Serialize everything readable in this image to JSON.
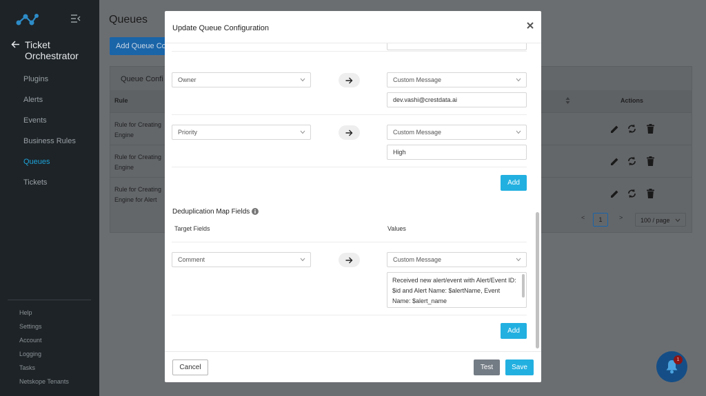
{
  "sidebar": {
    "title_line1": "Ticket",
    "title_line2": "Orchestrator",
    "items": [
      {
        "label": "Plugins"
      },
      {
        "label": "Alerts"
      },
      {
        "label": "Events"
      },
      {
        "label": "Business Rules"
      },
      {
        "label": "Queues",
        "active": true
      },
      {
        "label": "Tickets"
      }
    ],
    "footer": [
      {
        "label": "Help"
      },
      {
        "label": "Settings"
      },
      {
        "label": "Account"
      },
      {
        "label": "Logging"
      },
      {
        "label": "Tasks"
      },
      {
        "label": "Netskope Tenants"
      }
    ],
    "active_color": "#1ea3d8"
  },
  "main": {
    "page_title": "Queues",
    "add_button": "Add Queue Co",
    "card_title": "Queue Confi",
    "col_rule": "Rule",
    "col_actions": "Actions",
    "rows": [
      {
        "line1": "Rule for Creating",
        "line2": "Engine"
      },
      {
        "line1": "Rule for Creating",
        "line2": "Engine"
      },
      {
        "line1": "Rule for Creating",
        "line2": "Engine for Alert"
      }
    ],
    "pager": {
      "prev": "<",
      "page": "1",
      "next": ">",
      "page_size": "100 / page"
    }
  },
  "modal": {
    "title": "Update Queue Configuration",
    "mappings": [
      {
        "source": "Owner",
        "target": "Custom Message",
        "value": "dev.vashi@crestdata.ai"
      },
      {
        "source": "Priority",
        "target": "Custom Message",
        "value": "High"
      }
    ],
    "add_label": "Add",
    "dedup": {
      "title": "Deduplication Map Fields",
      "target_fields_label": "Target Fields",
      "values_label": "Values",
      "source": "Comment",
      "target": "Custom Message",
      "value": "Received new alert/event with Alert/Event ID: $id and Alert Name: $alertName, Event Name: $alert_name",
      "add_label": "Add"
    },
    "footer": {
      "cancel": "Cancel",
      "test": "Test",
      "save": "Save"
    },
    "accent_color": "#22b0e0"
  },
  "notifications": {
    "badge_count": "1"
  }
}
